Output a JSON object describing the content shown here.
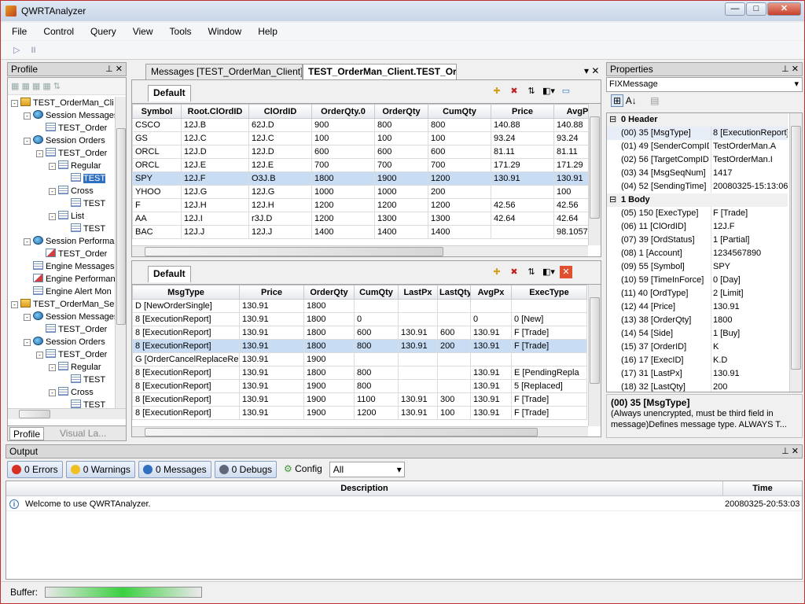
{
  "app": {
    "title": "QWRTAnalyzer"
  },
  "menu": [
    "File",
    "Control",
    "Query",
    "View",
    "Tools",
    "Window",
    "Help"
  ],
  "toolbar": {
    "play": "▷",
    "pause": "II"
  },
  "profile": {
    "header": "Profile",
    "tree": [
      {
        "label": "TEST_OrderMan_Cli",
        "level": 0,
        "icon": "folder",
        "exp": "-"
      },
      {
        "label": "Session Messages",
        "level": 1,
        "icon": "globe",
        "exp": "-"
      },
      {
        "label": "TEST_Order",
        "level": 2,
        "icon": "grid",
        "exp": ""
      },
      {
        "label": "Session Orders",
        "level": 1,
        "icon": "globe",
        "exp": "-"
      },
      {
        "label": "TEST_Order",
        "level": 2,
        "icon": "grid",
        "exp": "-"
      },
      {
        "label": "Regular",
        "level": 3,
        "icon": "grid",
        "exp": "-"
      },
      {
        "label": "TEST",
        "level": 4,
        "icon": "grid",
        "exp": "",
        "sel": true
      },
      {
        "label": "Cross",
        "level": 3,
        "icon": "grid",
        "exp": "-"
      },
      {
        "label": "TEST",
        "level": 4,
        "icon": "grid",
        "exp": ""
      },
      {
        "label": "List",
        "level": 3,
        "icon": "grid",
        "exp": "-"
      },
      {
        "label": "TEST",
        "level": 4,
        "icon": "grid",
        "exp": ""
      },
      {
        "label": "Session Performance",
        "level": 1,
        "icon": "globe",
        "exp": "-"
      },
      {
        "label": "TEST_Order",
        "level": 2,
        "icon": "chart",
        "exp": ""
      },
      {
        "label": "Engine Messages",
        "level": 1,
        "icon": "grid",
        "exp": ""
      },
      {
        "label": "Engine Performance",
        "level": 1,
        "icon": "chart",
        "exp": ""
      },
      {
        "label": "Engine Alert Mon",
        "level": 1,
        "icon": "grid",
        "exp": ""
      },
      {
        "label": "TEST_OrderMan_Se",
        "level": 0,
        "icon": "folder",
        "exp": "-"
      },
      {
        "label": "Session Messages",
        "level": 1,
        "icon": "globe",
        "exp": "-"
      },
      {
        "label": "TEST_Order",
        "level": 2,
        "icon": "grid",
        "exp": ""
      },
      {
        "label": "Session Orders",
        "level": 1,
        "icon": "globe",
        "exp": "-"
      },
      {
        "label": "TEST_Order",
        "level": 2,
        "icon": "grid",
        "exp": "-"
      },
      {
        "label": "Regular",
        "level": 3,
        "icon": "grid",
        "exp": "-"
      },
      {
        "label": "TEST",
        "level": 4,
        "icon": "grid",
        "exp": ""
      },
      {
        "label": "Cross",
        "level": 3,
        "icon": "grid",
        "exp": "-"
      },
      {
        "label": "TEST",
        "level": 4,
        "icon": "grid",
        "exp": ""
      }
    ],
    "bottom_tabs": [
      "Profile",
      "Visual La..."
    ]
  },
  "doc_tabs": [
    "Messages [TEST_OrderMan_Client]",
    "TEST_OrderMan_Client.TEST_Order"
  ],
  "top_grid": {
    "tab": "Default",
    "columns": [
      "Symbol",
      "Root.ClOrdID",
      "ClOrdID",
      "OrderQty.0",
      "OrderQty",
      "CumQty",
      "Price",
      "AvgP"
    ],
    "widths": [
      62,
      86,
      80,
      80,
      68,
      80,
      80,
      60
    ],
    "rows": [
      [
        "CSCO",
        "12J.B",
        "62J.D",
        "900",
        "800",
        "800",
        "140.88",
        "140.88"
      ],
      [
        "GS",
        "12J.C",
        "12J.C",
        "100",
        "100",
        "100",
        "93.24",
        "93.24"
      ],
      [
        "ORCL",
        "12J.D",
        "12J.D",
        "600",
        "600",
        "600",
        "81.11",
        "81.11"
      ],
      [
        "ORCL",
        "12J.E",
        "12J.E",
        "700",
        "700",
        "700",
        "171.29",
        "171.29"
      ],
      [
        "SPY",
        "12J.F",
        "O3J.B",
        "1800",
        "1900",
        "1200",
        "130.91",
        "130.91"
      ],
      [
        "YHOO",
        "12J.G",
        "12J.G",
        "1000",
        "1000",
        "200",
        "",
        "100"
      ],
      [
        "F",
        "12J.H",
        "12J.H",
        "1200",
        "1200",
        "1200",
        "42.56",
        "42.56"
      ],
      [
        "AA",
        "12J.I",
        "r3J.D",
        "1200",
        "1300",
        "1300",
        "42.64",
        "42.64"
      ],
      [
        "BAC",
        "12J.J",
        "12J.J",
        "1400",
        "1400",
        "1400",
        "",
        "98.1057"
      ]
    ],
    "selected": 4
  },
  "bottom_grid": {
    "tab": "Default",
    "columns": [
      "MsgType",
      "Price",
      "OrderQty",
      "CumQty",
      "LastPx",
      "LastQty",
      "AvgPx",
      "ExecType"
    ],
    "widths": [
      136,
      82,
      64,
      56,
      50,
      42,
      52,
      96
    ],
    "rows": [
      [
        "D [NewOrderSingle]",
        "130.91",
        "1800",
        "",
        "",
        "",
        "",
        ""
      ],
      [
        "8 [ExecutionReport]",
        "130.91",
        "1800",
        "0",
        "",
        "",
        "0",
        "0 [New]"
      ],
      [
        "8 [ExecutionReport]",
        "130.91",
        "1800",
        "600",
        "130.91",
        "600",
        "130.91",
        "F [Trade]"
      ],
      [
        "8 [ExecutionReport]",
        "130.91",
        "1800",
        "800",
        "130.91",
        "200",
        "130.91",
        "F [Trade]"
      ],
      [
        "G [OrderCancelReplaceRe",
        "130.91",
        "1900",
        "",
        "",
        "",
        "",
        ""
      ],
      [
        "8 [ExecutionReport]",
        "130.91",
        "1800",
        "800",
        "",
        "",
        "130.91",
        "E [PendingRepla"
      ],
      [
        "8 [ExecutionReport]",
        "130.91",
        "1900",
        "800",
        "",
        "",
        "130.91",
        "5 [Replaced]"
      ],
      [
        "8 [ExecutionReport]",
        "130.91",
        "1900",
        "1100",
        "130.91",
        "300",
        "130.91",
        "F [Trade]"
      ],
      [
        "8 [ExecutionReport]",
        "130.91",
        "1900",
        "1200",
        "130.91",
        "100",
        "130.91",
        "F [Trade]"
      ]
    ],
    "selected": 3
  },
  "properties": {
    "header": "Properties",
    "object": "FIXMessage",
    "items": [
      {
        "cat": "0 Header"
      },
      {
        "k": "(00) 35 [MsgType]",
        "v": "8 [ExecutionReport]"
      },
      {
        "k": "(01) 49 [SenderCompID]",
        "v": "TestOrderMan.A"
      },
      {
        "k": "(02) 56 [TargetCompID]",
        "v": "TestOrderMan.I"
      },
      {
        "k": "(03) 34 [MsgSeqNum]",
        "v": "1417"
      },
      {
        "k": "(04) 52 [SendingTime]",
        "v": "20080325-15:13:06"
      },
      {
        "cat": "1 Body"
      },
      {
        "k": "(05) 150 [ExecType]",
        "v": "F [Trade]"
      },
      {
        "k": "(06) 11 [ClOrdID]",
        "v": "12J.F"
      },
      {
        "k": "(07) 39 [OrdStatus]",
        "v": "1 [Partial]"
      },
      {
        "k": "(08) 1 [Account]",
        "v": "1234567890"
      },
      {
        "k": "(09) 55 [Symbol]",
        "v": "SPY"
      },
      {
        "k": "(10) 59 [TimeInForce]",
        "v": "0 [Day]"
      },
      {
        "k": "(11) 40 [OrdType]",
        "v": "2 [Limit]"
      },
      {
        "k": "(12) 44 [Price]",
        "v": "130.91"
      },
      {
        "k": "(13) 38 [OrderQty]",
        "v": "1800"
      },
      {
        "k": "(14) 54 [Side]",
        "v": "1 [Buy]"
      },
      {
        "k": "(15) 37 [OrderID]",
        "v": "K"
      },
      {
        "k": "(16) 17 [ExecID]",
        "v": "K.D"
      },
      {
        "k": "(17) 31 [LastPx]",
        "v": "130.91"
      },
      {
        "k": "(18) 32 [LastQty]",
        "v": "200"
      }
    ],
    "desc_title": "(00) 35 [MsgType]",
    "desc_text": "(Always unencrypted, must be third field in message)Defines message type.    ALWAYS T..."
  },
  "output": {
    "header": "Output",
    "buttons": [
      {
        "label": "0 Errors",
        "color": "#d83020"
      },
      {
        "label": "0 Warnings",
        "color": "#f0c020"
      },
      {
        "label": "0 Messages",
        "color": "#3070c0"
      },
      {
        "label": "0 Debugs",
        "color": "#606878"
      }
    ],
    "config": "Config",
    "filter": "All",
    "columns": [
      "Description",
      "Time"
    ],
    "rows": [
      [
        "Welcome to use QWRTAnalyzer.",
        "20080325-20:53:03"
      ]
    ]
  },
  "status": {
    "buffer_label": "Buffer:",
    "buffer_fill": 0.21
  }
}
